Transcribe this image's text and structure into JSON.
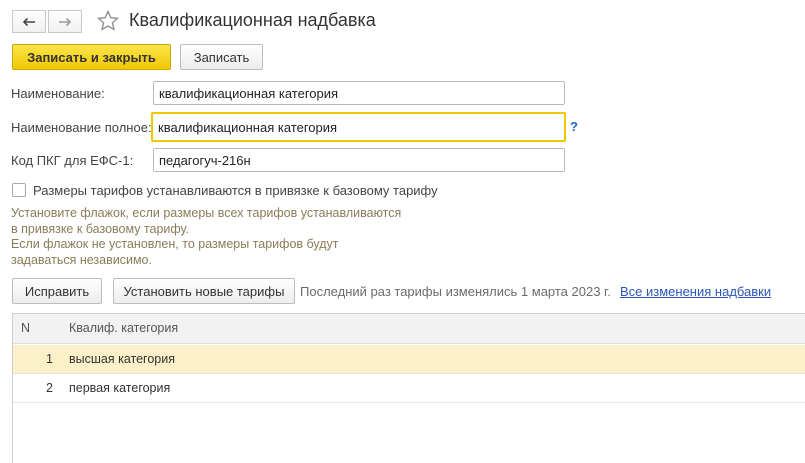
{
  "header": {
    "title": "Квалификационная надбавка",
    "back_icon": "arrow-left-icon",
    "forward_icon": "arrow-right-icon",
    "favorite_icon": "star-icon"
  },
  "toolbar": {
    "save_close_label": "Записать и закрыть",
    "save_label": "Записать"
  },
  "form": {
    "name_label": "Наименование:",
    "name_value": "квалификационная категория",
    "full_name_label": "Наименование полное:",
    "full_name_value": "квалификационная категория",
    "help_mark": "?",
    "pkg_label": "Код ПКГ для ЕФС-1:",
    "pkg_value": "педагогуч-216н",
    "checkbox_label": "Размеры тарифов устанавливаются в привязке к базовому тарифу",
    "checkbox_checked": false,
    "hint_lines": [
      "Установите флажок, если размеры всех тарифов устанавливаются",
      "в привязке к базовому тарифу.",
      "Если флажок не установлен, то размеры тарифов будут",
      "задаваться независимо."
    ]
  },
  "tariff_bar": {
    "edit_label": "Исправить",
    "set_new_label": "Установить новые тарифы",
    "last_changed_text": "Последний раз тарифы изменялись 1 марта 2023 г.",
    "all_changes_link": "Все изменения надбавки"
  },
  "table": {
    "columns": [
      "N",
      "Квалиф. категория"
    ],
    "rows": [
      {
        "n": "1",
        "name": "высшая категория",
        "selected": true
      },
      {
        "n": "2",
        "name": "первая категория",
        "selected": false
      }
    ]
  },
  "colors": {
    "accent_yellow": "#f1c800",
    "selected_row": "#fbf0c7",
    "link_blue": "#2b56b8",
    "hint_text": "#8a7c58"
  }
}
